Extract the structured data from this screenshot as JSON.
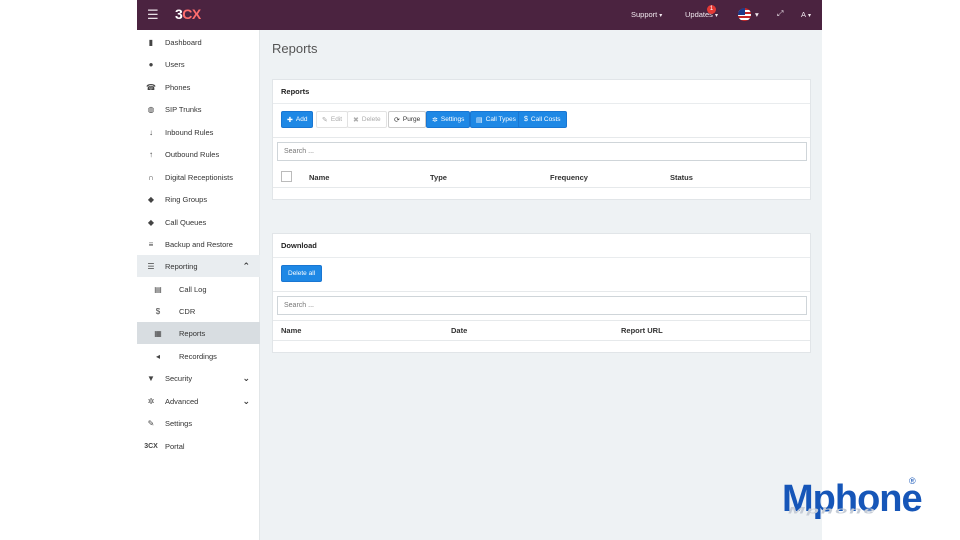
{
  "app": {
    "logo_num": "3",
    "logo_cx": "CX",
    "menu_icon": "hamburger-icon"
  },
  "topbar": {
    "support": "Support",
    "updates": "Updates",
    "updates_badge": "1",
    "language": "us-flag-icon",
    "expand_icon": "expand-icon",
    "account": "A"
  },
  "sidebar": {
    "items": [
      {
        "label": "Dashboard",
        "icon": "bar-chart-icon",
        "glyph": "▮"
      },
      {
        "label": "Users",
        "icon": "user-icon",
        "glyph": "●"
      },
      {
        "label": "Phones",
        "icon": "phone-icon",
        "glyph": "☎"
      },
      {
        "label": "SIP Trunks",
        "icon": "globe-icon",
        "glyph": "◍"
      },
      {
        "label": "Inbound Rules",
        "icon": "arrow-down-icon",
        "glyph": "↓"
      },
      {
        "label": "Outbound Rules",
        "icon": "arrow-up-icon",
        "glyph": "↑"
      },
      {
        "label": "Digital Receptionists",
        "icon": "headset-icon",
        "glyph": "∩"
      },
      {
        "label": "Ring Groups",
        "icon": "group-icon",
        "glyph": "◆"
      },
      {
        "label": "Call Queues",
        "icon": "users-icon",
        "glyph": "◆"
      },
      {
        "label": "Backup and Restore",
        "icon": "database-icon",
        "glyph": "≡"
      },
      {
        "label": "Reporting",
        "icon": "list-icon",
        "glyph": "☰"
      },
      {
        "label": "Call Log",
        "icon": "book-icon",
        "glyph": "▤"
      },
      {
        "label": "CDR",
        "icon": "dollar-icon",
        "glyph": "$"
      },
      {
        "label": "Reports",
        "icon": "report-icon",
        "glyph": "▦"
      },
      {
        "label": "Recordings",
        "icon": "speaker-icon",
        "glyph": "◂"
      },
      {
        "label": "Security",
        "icon": "shield-icon",
        "glyph": "▼"
      },
      {
        "label": "Advanced",
        "icon": "gear-icon",
        "glyph": "✲"
      },
      {
        "label": "Settings",
        "icon": "wrench-icon",
        "glyph": "✎"
      },
      {
        "label": "Portal",
        "icon": "3cx-icon",
        "glyph": "3CX"
      }
    ]
  },
  "main": {
    "page_title": "Reports",
    "reports_panel": {
      "title": "Reports",
      "buttons": {
        "add": "Add",
        "edit": "Edit",
        "delete": "Delete",
        "purge": "Purge",
        "settings": "Settings",
        "call_types": "Call Types",
        "call_costs": "Call Costs"
      },
      "search_placeholder": "Search ...",
      "columns": [
        "Name",
        "Type",
        "Frequency",
        "Status"
      ]
    },
    "download_panel": {
      "title": "Download",
      "delete_all": "Delete all",
      "search_placeholder": "Search ...",
      "columns": [
        "Name",
        "Date",
        "Report URL"
      ]
    }
  },
  "brand": {
    "name": "Mphone",
    "reflection": "Mphone",
    "registered": "®"
  },
  "colors": {
    "topbar": "#4b2340",
    "primary_button": "#1e88e5",
    "brand": "#1656b8"
  }
}
